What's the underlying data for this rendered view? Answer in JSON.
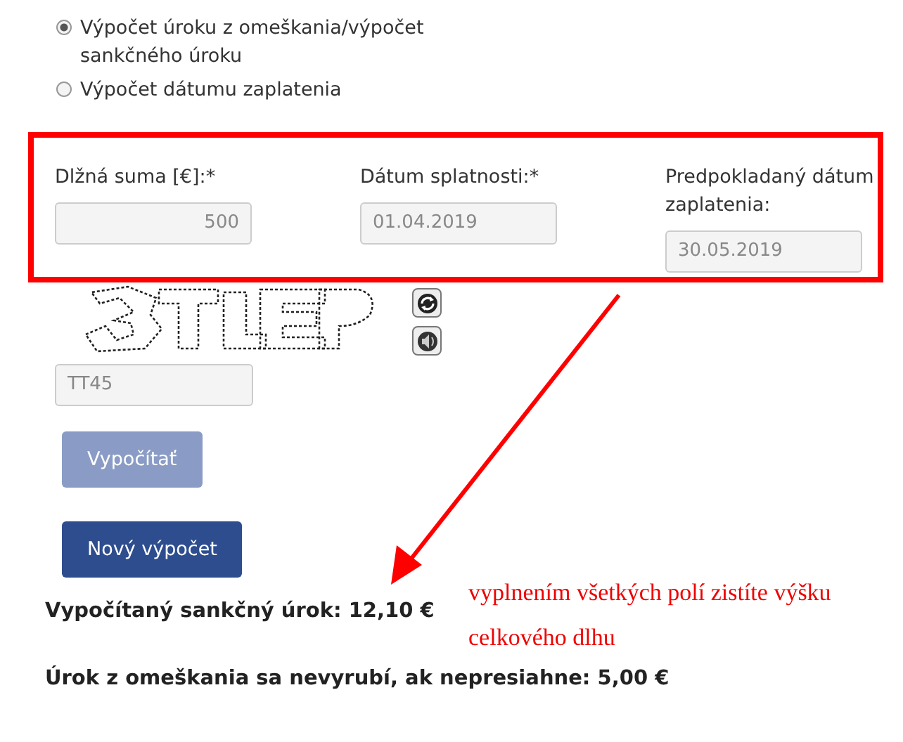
{
  "mode_options": [
    {
      "label": "Výpočet úroku z omeškania/výpočet sankčného úroku",
      "selected": true
    },
    {
      "label": "Výpočet dátumu zaplatenia",
      "selected": false
    }
  ],
  "fields": [
    {
      "label": "Dlžná suma [€]:*",
      "value": "500",
      "kind": "number"
    },
    {
      "label": "Dátum splatnosti:*",
      "value": "01.04.2019",
      "kind": "date"
    },
    {
      "label": "Predpokladaný dátum zaplatenia:",
      "value": "30.05.2019",
      "kind": "date"
    }
  ],
  "captcha": {
    "kind": "picture",
    "value": "TT45"
  },
  "buttons": [
    {
      "label": "Vypočítať",
      "disabled": true
    },
    {
      "label": "Nový výpočet",
      "disabled": false
    }
  ],
  "results": [
    "Vypočítaný sankčný úrok: 12,10 €",
    "Úrok z omeškania sa nevyrubí, ak nepresiahne: 5,00 €"
  ],
  "annotation": "vyplnením všetkých polí zistíte výšku celkového dlhu"
}
